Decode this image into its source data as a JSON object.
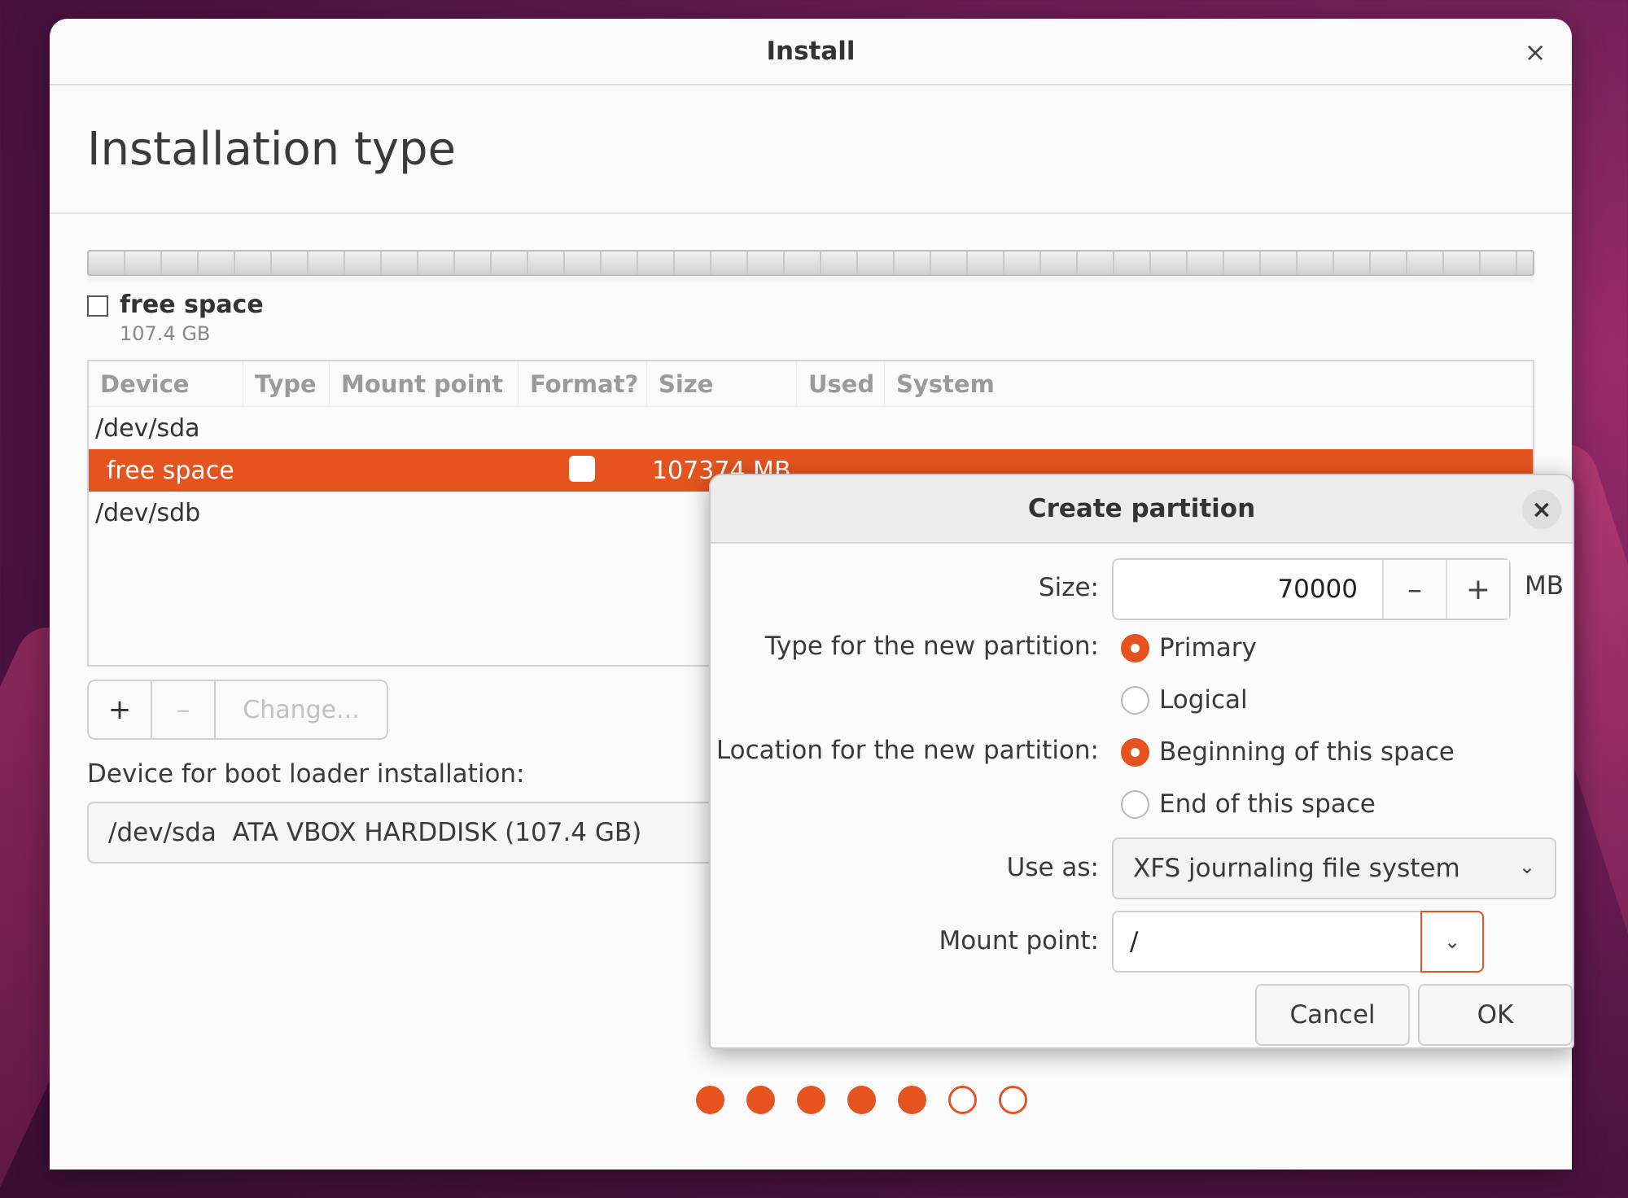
{
  "window": {
    "title": "Install",
    "close_glyph": "×",
    "page_title": "Installation type"
  },
  "partition_legend": {
    "name": "free space",
    "size": "107.4 GB"
  },
  "table": {
    "columns": [
      "Device",
      "Type",
      "Mount point",
      "Format?",
      "Size",
      "Used",
      "System"
    ],
    "rows": [
      {
        "device": "/dev/sda"
      },
      {
        "device": "free space",
        "size": "107374 MB",
        "selected": true
      },
      {
        "device": "/dev/sdb"
      }
    ]
  },
  "table_buttons": {
    "add": "+",
    "remove": "–",
    "change": "Change..."
  },
  "boot_loader": {
    "label": "Device for boot loader installation:",
    "value": "/dev/sda  ATA VBOX HARDDISK (107.4 GB)"
  },
  "progress": {
    "total_steps": 7,
    "completed_steps": 5
  },
  "dialog": {
    "title": "Create partition",
    "close_glyph": "×",
    "size_label": "Size:",
    "size_value": "70000",
    "size_unit": "MB",
    "decrement": "–",
    "increment": "+",
    "type_label": "Type for the new partition:",
    "type_options": [
      "Primary",
      "Logical"
    ],
    "type_selected": "Primary",
    "location_label": "Location for the new partition:",
    "location_options": [
      "Beginning of this space",
      "End of this space"
    ],
    "location_selected": "Beginning of this space",
    "use_as_label": "Use as:",
    "use_as_value": "XFS journaling file system",
    "mount_label": "Mount point:",
    "mount_value": "/",
    "cancel": "Cancel",
    "ok": "OK"
  },
  "colors": {
    "accent": "#e5541f",
    "background": "#fafafa"
  },
  "icons": [
    "close-icon",
    "chevron-down-icon",
    "plus-icon",
    "minus-icon"
  ]
}
